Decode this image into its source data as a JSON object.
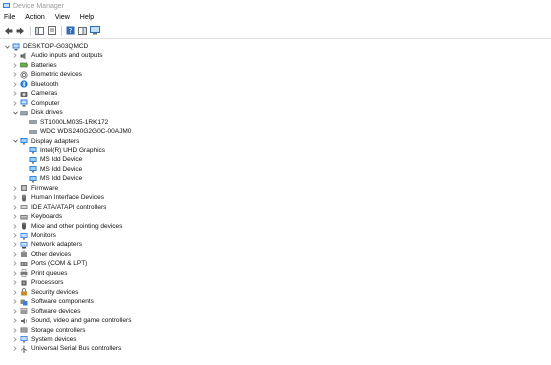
{
  "window": {
    "title": "Device Manager"
  },
  "menu": {
    "file": "File",
    "action": "Action",
    "view": "View",
    "help": "Help"
  },
  "colors": {
    "selection": "#cce8ff",
    "accent": "#2f6db5",
    "text": "#000000"
  },
  "tree": {
    "root": "DESKTOP-G03QMCD",
    "categories": [
      {
        "label": "Audio inputs and outputs",
        "icon": "speaker-icon"
      },
      {
        "label": "Batteries",
        "icon": "battery-icon"
      },
      {
        "label": "Biometric devices",
        "icon": "biometric-icon"
      },
      {
        "label": "Bluetooth",
        "icon": "bluetooth-icon"
      },
      {
        "label": "Cameras",
        "icon": "camera-icon"
      },
      {
        "label": "Computer",
        "icon": "computer-icon"
      },
      {
        "label": "Disk drives",
        "icon": "disk-icon",
        "expanded": true,
        "children": [
          "ST1000LM035-1RK172",
          "WDC WDS240G2G0C-00AJM0"
        ]
      },
      {
        "label": "Display adapters",
        "icon": "display-icon",
        "expanded": true,
        "children": [
          "Intel(R) UHD Graphics",
          "MS Idd Device",
          "MS Idd Device",
          "MS Idd Device"
        ]
      },
      {
        "label": "Firmware",
        "icon": "firmware-icon"
      },
      {
        "label": "Human Interface Devices",
        "icon": "hid-icon"
      },
      {
        "label": "IDE ATA/ATAPI controllers",
        "icon": "ide-icon"
      },
      {
        "label": "Keyboards",
        "icon": "keyboard-icon"
      },
      {
        "label": "Mice and other pointing devices",
        "icon": "mouse-icon"
      },
      {
        "label": "Monitors",
        "icon": "monitor-icon"
      },
      {
        "label": "Network adapters",
        "icon": "network-icon"
      },
      {
        "label": "Other devices",
        "icon": "unknown-device-icon"
      },
      {
        "label": "Ports (COM & LPT)",
        "icon": "port-icon"
      },
      {
        "label": "Print queues",
        "icon": "printer-icon"
      },
      {
        "label": "Processors",
        "icon": "processor-icon"
      },
      {
        "label": "Security devices",
        "icon": "security-icon"
      },
      {
        "label": "Software components",
        "icon": "software-component-icon"
      },
      {
        "label": "Software devices",
        "icon": "software-device-icon"
      },
      {
        "label": "Sound, video and game controllers",
        "icon": "sound-icon"
      },
      {
        "label": "Storage controllers",
        "icon": "storage-icon"
      },
      {
        "label": "System devices",
        "icon": "system-icon"
      },
      {
        "label": "Universal Serial Bus controllers",
        "icon": "usb-icon"
      }
    ]
  }
}
